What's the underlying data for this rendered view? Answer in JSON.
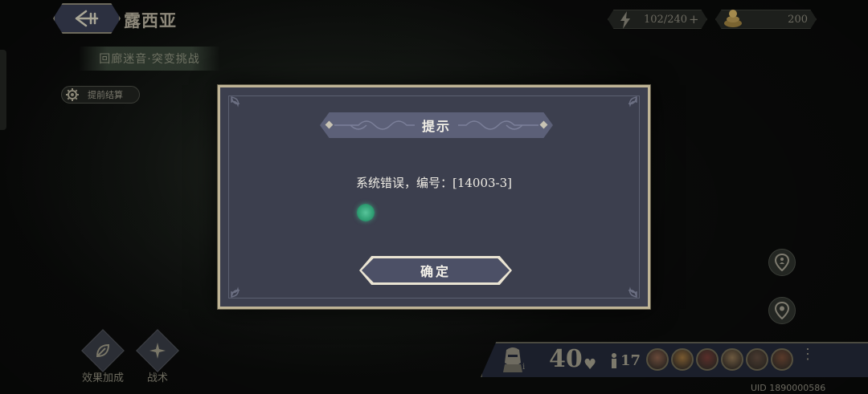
{
  "header": {
    "level_title": "露西亚",
    "subtitle": "回廊迷音·突变挑战",
    "settle_early_label": "提前结算"
  },
  "resources": {
    "energy": "102/240",
    "energy_plus": "+",
    "gold": "200"
  },
  "bottom_left": {
    "skills": [
      {
        "label": "效果加成",
        "icon": "leaf-icon"
      },
      {
        "label": "战术",
        "icon": "compass-star-icon"
      }
    ]
  },
  "party": {
    "hp": "40",
    "heart": "♥",
    "member_count": "17",
    "portrait_count": 6,
    "knight_sub": "i",
    "more": "⋮"
  },
  "uid": "UID 1890000586",
  "dialog": {
    "title": "提示",
    "message": "系统错误，编号：[14003-3]",
    "confirm_label": "确定"
  },
  "colors": {
    "dialog_bg": "#3c3f4e",
    "dialog_border": "#bfb496",
    "header_bg": "#5c6078",
    "touch_indicator": "#2f9e73"
  }
}
